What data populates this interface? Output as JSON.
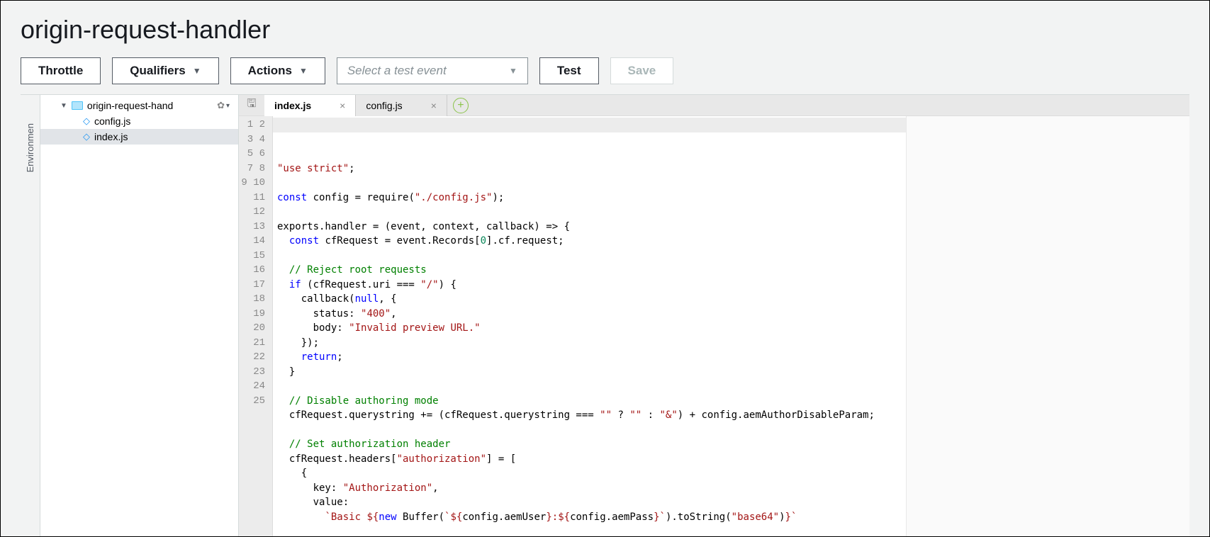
{
  "page": {
    "title": "origin-request-handler"
  },
  "toolbar": {
    "throttle": "Throttle",
    "qualifiers": "Qualifiers",
    "actions": "Actions",
    "test_select_placeholder": "Select a test event",
    "test": "Test",
    "save": "Save"
  },
  "panels": {
    "collapsed_left": "Environmen"
  },
  "file_tree": {
    "root": "origin-request-hand",
    "files": [
      "config.js",
      "index.js"
    ],
    "active": "index.js"
  },
  "tabs": [
    {
      "label": "index.js",
      "active": true
    },
    {
      "label": "config.js",
      "active": false
    }
  ],
  "editor": {
    "line_count": 25,
    "code_html": "<span class=\"str\">\"use strict\"</span>;\n\n<span class=\"kw\">const</span> config = require(<span class=\"str\">\"./config.js\"</span>);\n\nexports.handler = (event, context, callback) =&gt; {\n  <span class=\"kw\">const</span> cfRequest = event.Records[<span class=\"num\">0</span>].cf.request;\n\n  <span class=\"com\">// Reject root requests</span>\n  <span class=\"kw\">if</span> (cfRequest.uri === <span class=\"str\">\"/\"</span>) {\n    callback(<span class=\"kw\">null</span>, {\n      status: <span class=\"str\">\"400\"</span>,\n      body: <span class=\"str\">\"Invalid preview URL.\"</span>\n    });\n    <span class=\"kw\">return</span>;\n  }\n\n  <span class=\"com\">// Disable authoring mode</span>\n  cfRequest.querystring += (cfRequest.querystring === <span class=\"str\">\"\"</span> ? <span class=\"str\">\"\"</span> : <span class=\"str\">\"&amp;\"</span>) + config.aemAuthorDisableParam;\n\n  <span class=\"com\">// Set authorization header</span>\n  cfRequest.headers[<span class=\"str\">\"authorization\"</span>] = [\n    {\n      key: <span class=\"str\">\"Authorization\"</span>,\n      value:\n        <span class=\"str\">`Basic ${</span><span class=\"kw\">new</span> Buffer(<span class=\"str\">`${</span>config.aemUser<span class=\"str\">}:${</span>config.aemPass<span class=\"str\">}`</span>).toString(<span class=\"str\">\"base64\"</span>)<span class=\"str\">}`</span>"
  }
}
